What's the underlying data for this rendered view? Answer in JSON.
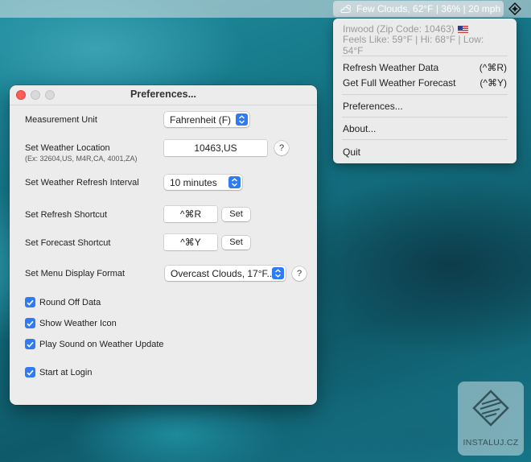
{
  "menubar": {
    "status_text": "Few Clouds, 62°F | 36% | 20 mph"
  },
  "dropdown": {
    "location": "Inwood (Zip Code: 10463)",
    "feels_like": "Feels Like: 59°F | Hi: 68°F | Low: 54°F",
    "items": [
      {
        "label": "Refresh Weather Data",
        "shortcut": "(^⌘R)"
      },
      {
        "label": "Get Full Weather Forecast",
        "shortcut": "(^⌘Y)"
      },
      {
        "label": "Preferences..."
      },
      {
        "label": "About..."
      },
      {
        "label": "Quit"
      }
    ]
  },
  "prefs": {
    "title": "Preferences...",
    "measurement_unit": {
      "label": "Measurement Unit",
      "value": "Fahrenheit (F)"
    },
    "location": {
      "label": "Set Weather Location",
      "hint": "(Ex: 32604,US, M4R,CA, 4001,ZA)",
      "value": "10463,US",
      "help": "?"
    },
    "refresh_interval": {
      "label": "Set Weather Refresh Interval",
      "value": "10 minutes"
    },
    "refresh_shortcut": {
      "label": "Set Refresh Shortcut",
      "value": "^⌘R",
      "button": "Set"
    },
    "forecast_shortcut": {
      "label": "Set Forecast Shortcut",
      "value": "^⌘Y",
      "button": "Set"
    },
    "display_format": {
      "label": "Set Menu Display Format",
      "value": "Overcast Clouds, 17°F...",
      "help": "?"
    },
    "checkboxes": [
      {
        "label": "Round Off Data",
        "checked": true
      },
      {
        "label": "Show Weather Icon",
        "checked": true
      },
      {
        "label": "Play Sound on Weather Update",
        "checked": true
      },
      {
        "label": "Start at Login",
        "checked": true
      }
    ]
  },
  "watermark": {
    "text": "INSTALUJ.CZ"
  },
  "colors": {
    "accent": "#2f7bf5",
    "close": "#ff5f57"
  }
}
